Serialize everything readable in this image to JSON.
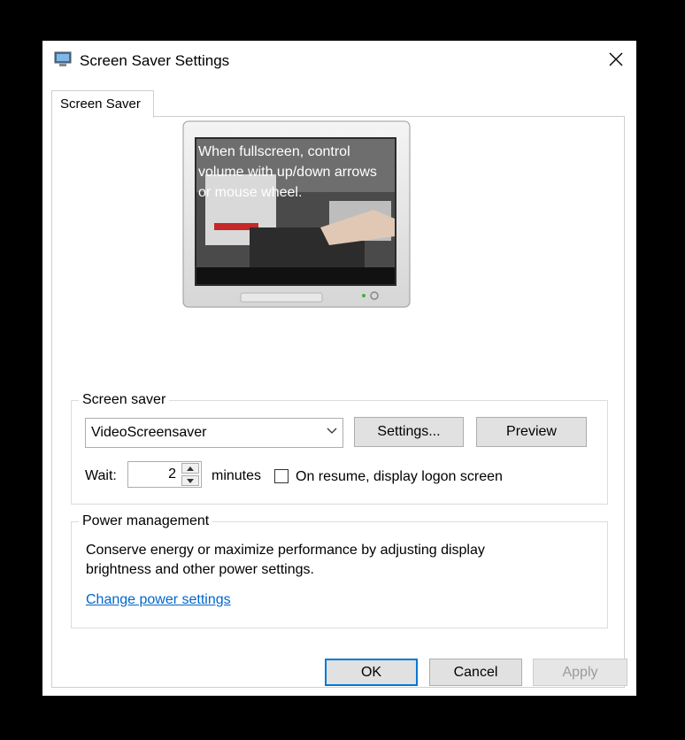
{
  "window": {
    "title": "Screen Saver Settings",
    "icon": "monitor-icon",
    "close_icon": "close-icon"
  },
  "tabs": [
    {
      "label": "Screen Saver",
      "selected": true
    }
  ],
  "preview": {
    "overlay_text": "When fullscreen, control volume with up/down arrows or mouse wheel."
  },
  "screen_saver": {
    "group_label": "Screen saver",
    "selected": "VideoScreensaver",
    "settings_button": "Settings...",
    "preview_button": "Preview",
    "wait_label": "Wait:",
    "wait_value": "2",
    "minutes_label": "minutes",
    "resume_checkbox_label": "On resume, display logon screen",
    "resume_checked": false
  },
  "power": {
    "group_label": "Power management",
    "description_line1": "Conserve energy or maximize performance by adjusting display",
    "description_line2": "brightness and other power settings.",
    "link": "Change power settings"
  },
  "footer": {
    "ok": "OK",
    "cancel": "Cancel",
    "apply": "Apply"
  },
  "colors": {
    "accent": "#0078d7",
    "link": "#0066cc",
    "disabled_text": "#9a9a9a"
  }
}
